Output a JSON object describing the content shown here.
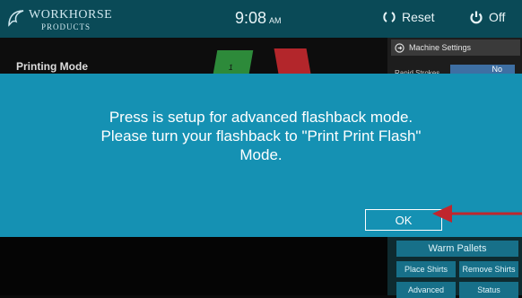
{
  "header": {
    "brand_name": "WORKHORSE",
    "brand_sub": "PRODUCTS",
    "time": "9:08",
    "ampm": "AM",
    "reset_label": "Reset",
    "off_label": "Off"
  },
  "background": {
    "printing_mode_label": "Printing Mode",
    "pallet_number": "1",
    "machine_settings_label": "Machine Settings",
    "rapid_strokes_label": "Rapid Strokes",
    "rapid_strokes_value": "No"
  },
  "dialog": {
    "message_line1": "Press is setup for advanced flashback mode.",
    "message_line2": "Please turn your flashback to \"Print Print Flash\"",
    "message_line3": "Mode.",
    "ok_label": "OK"
  },
  "bottom_panel": {
    "warm_pallets": "Warm Pallets",
    "place_shirts": "Place Shirts",
    "remove_shirts": "Remove Shirts",
    "advanced": "Advanced",
    "status": "Status"
  },
  "colors": {
    "dialog_bg": "#1591b3",
    "topbar_bg": "#0a4a57",
    "arrow": "#c0262d"
  }
}
